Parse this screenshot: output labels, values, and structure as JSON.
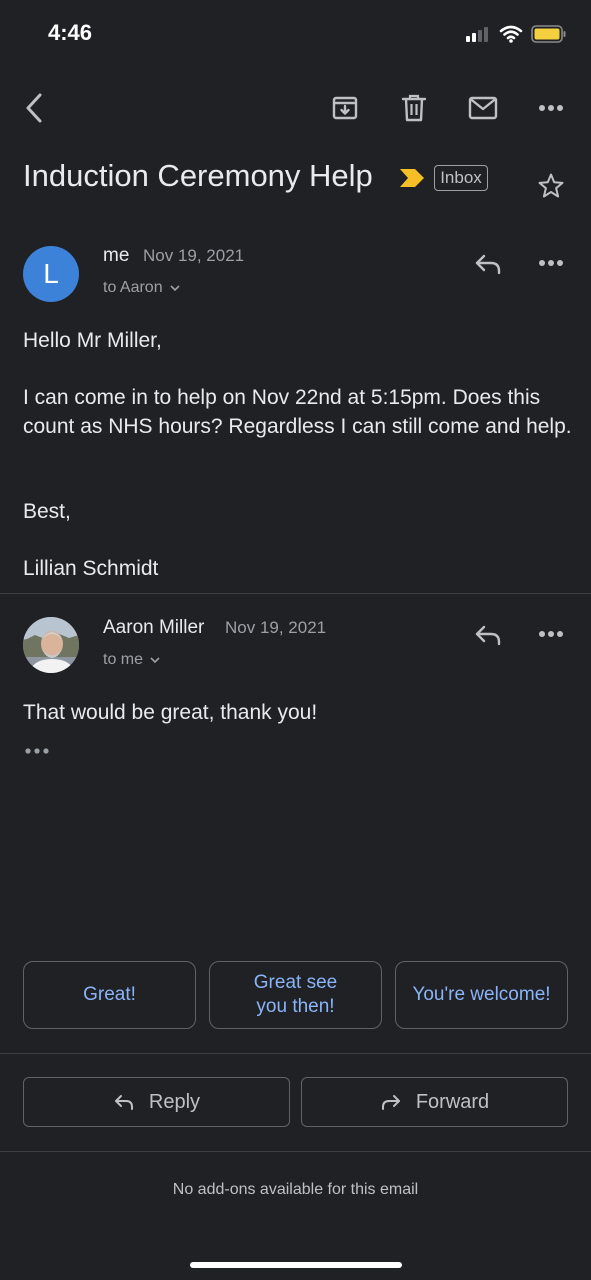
{
  "status_bar": {
    "time": "4:46"
  },
  "toolbar": {
    "back_icon": "chevron-left-icon",
    "archive_icon": "archive-icon",
    "delete_icon": "trash-icon",
    "unread_icon": "mail-icon",
    "more_icon": "more-horiz-icon"
  },
  "thread": {
    "subject": "Induction Ceremony Help",
    "label": "Inbox",
    "importance_color": "#f6bf26"
  },
  "messages": [
    {
      "avatar_letter": "L",
      "avatar_color": "#3c82d8",
      "sender": "me",
      "date": "Nov 19, 2021",
      "recipient": "to Aaron",
      "body": {
        "greeting": "Hello Mr Miller,",
        "paragraph": "I can come in to help on Nov 22nd at 5:15pm. Does this count as NHS hours? Regardless I can still come and help.",
        "closing": "Best,",
        "signature": "Lillian Schmidt"
      }
    },
    {
      "sender": "Aaron Miller",
      "date": "Nov 19, 2021",
      "recipient": "to me",
      "body": {
        "text": "That would be great, thank you!"
      }
    }
  ],
  "smart_replies": [
    "Great!",
    "Great see you then!",
    "You're welcome!"
  ],
  "actions": {
    "reply": "Reply",
    "forward": "Forward"
  },
  "footer": {
    "note": "No add-ons available for this email"
  }
}
